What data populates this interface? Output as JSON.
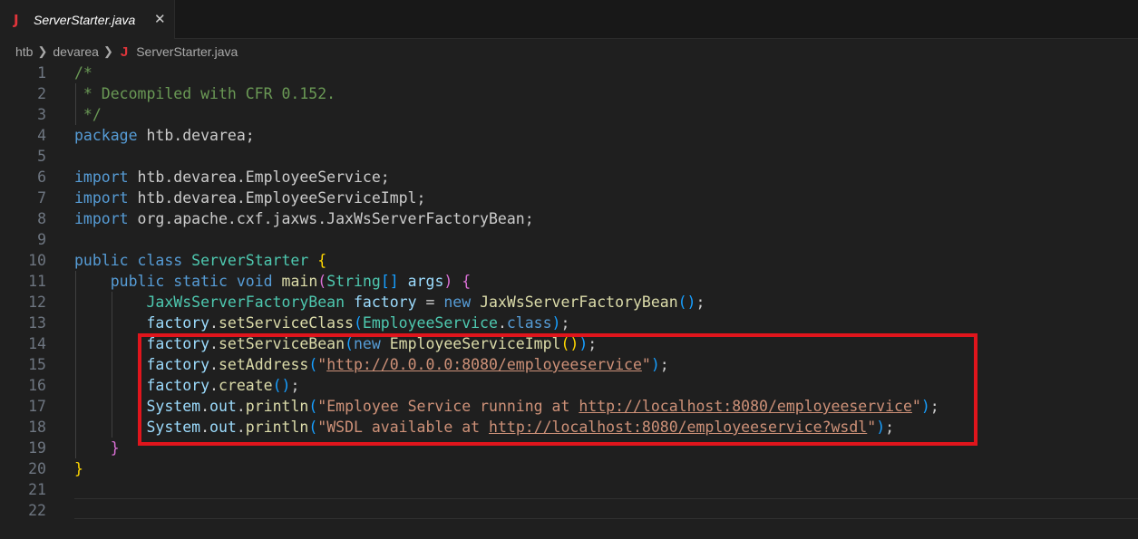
{
  "tab": {
    "icon": "java-file-icon",
    "label": "ServerStarter.java",
    "close_icon": "close-icon"
  },
  "breadcrumb": {
    "items": [
      "htb",
      "devarea"
    ],
    "file_icon": "java-file-icon",
    "file": "ServerStarter.java"
  },
  "colors": {
    "comment": "#6a9955",
    "keyword": "#569cd6",
    "type": "#4ec9b0",
    "function": "#dcdcaa",
    "variable": "#9cdcfe",
    "string": "#ce9178",
    "highlight_box": "#e0151c"
  },
  "editor": {
    "lines": [
      {
        "n": "1",
        "tokens": [
          [
            "comment",
            "/*"
          ]
        ]
      },
      {
        "n": "2",
        "tokens": [
          [
            "comment",
            " * Decompiled with CFR 0.152."
          ]
        ]
      },
      {
        "n": "3",
        "tokens": [
          [
            "comment",
            " */"
          ]
        ]
      },
      {
        "n": "4",
        "tokens": [
          [
            "kw",
            "package"
          ],
          [
            "plain",
            " htb.devarea;"
          ]
        ]
      },
      {
        "n": "5",
        "tokens": []
      },
      {
        "n": "6",
        "tokens": [
          [
            "kw",
            "import"
          ],
          [
            "plain",
            " htb.devarea.EmployeeService;"
          ]
        ]
      },
      {
        "n": "7",
        "tokens": [
          [
            "kw",
            "import"
          ],
          [
            "plain",
            " htb.devarea.EmployeeServiceImpl;"
          ]
        ]
      },
      {
        "n": "8",
        "tokens": [
          [
            "kw",
            "import"
          ],
          [
            "plain",
            " org.apache.cxf.jaxws.JaxWsServerFactoryBean;"
          ]
        ]
      },
      {
        "n": "9",
        "tokens": []
      },
      {
        "n": "10",
        "tokens": [
          [
            "kw",
            "public"
          ],
          [
            "plain",
            " "
          ],
          [
            "kw",
            "class"
          ],
          [
            "plain",
            " "
          ],
          [
            "type",
            "ServerStarter"
          ],
          [
            "plain",
            " "
          ],
          [
            "b1",
            "{"
          ]
        ]
      },
      {
        "n": "11",
        "tokens": [
          [
            "plain",
            "    "
          ],
          [
            "kw",
            "public"
          ],
          [
            "plain",
            " "
          ],
          [
            "kw",
            "static"
          ],
          [
            "plain",
            " "
          ],
          [
            "kw",
            "void"
          ],
          [
            "plain",
            " "
          ],
          [
            "fn",
            "main"
          ],
          [
            "b2",
            "("
          ],
          [
            "type",
            "String"
          ],
          [
            "b3",
            "[]"
          ],
          [
            "plain",
            " "
          ],
          [
            "var",
            "args"
          ],
          [
            "b2",
            ")"
          ],
          [
            "plain",
            " "
          ],
          [
            "b2",
            "{"
          ]
        ]
      },
      {
        "n": "12",
        "tokens": [
          [
            "plain",
            "        "
          ],
          [
            "type",
            "JaxWsServerFactoryBean"
          ],
          [
            "plain",
            " "
          ],
          [
            "var",
            "factory"
          ],
          [
            "plain",
            " = "
          ],
          [
            "kw",
            "new"
          ],
          [
            "plain",
            " "
          ],
          [
            "fn",
            "JaxWsServerFactoryBean"
          ],
          [
            "b3",
            "()"
          ],
          [
            "plain",
            ";"
          ]
        ]
      },
      {
        "n": "13",
        "tokens": [
          [
            "plain",
            "        "
          ],
          [
            "var",
            "factory"
          ],
          [
            "plain",
            "."
          ],
          [
            "fn",
            "setServiceClass"
          ],
          [
            "b3",
            "("
          ],
          [
            "type",
            "EmployeeService"
          ],
          [
            "plain",
            "."
          ],
          [
            "kw",
            "class"
          ],
          [
            "b3",
            ")"
          ],
          [
            "plain",
            ";"
          ]
        ]
      },
      {
        "n": "14",
        "tokens": [
          [
            "plain",
            "        "
          ],
          [
            "var",
            "factory"
          ],
          [
            "plain",
            "."
          ],
          [
            "fn",
            "setServiceBean"
          ],
          [
            "b3",
            "("
          ],
          [
            "kw",
            "new"
          ],
          [
            "plain",
            " "
          ],
          [
            "fn",
            "EmployeeServiceImpl"
          ],
          [
            "b1",
            "()"
          ],
          [
            "b3",
            ")"
          ],
          [
            "plain",
            ";"
          ]
        ]
      },
      {
        "n": "15",
        "tokens": [
          [
            "plain",
            "        "
          ],
          [
            "var",
            "factory"
          ],
          [
            "plain",
            "."
          ],
          [
            "fn",
            "setAddress"
          ],
          [
            "b3",
            "("
          ],
          [
            "str",
            "\""
          ],
          [
            "str url",
            "http://0.0.0.0:8080/employeeservice"
          ],
          [
            "str",
            "\""
          ],
          [
            "b3",
            ")"
          ],
          [
            "plain",
            ";"
          ]
        ]
      },
      {
        "n": "16",
        "tokens": [
          [
            "plain",
            "        "
          ],
          [
            "var",
            "factory"
          ],
          [
            "plain",
            "."
          ],
          [
            "fn",
            "create"
          ],
          [
            "b3",
            "()"
          ],
          [
            "plain",
            ";"
          ]
        ]
      },
      {
        "n": "17",
        "tokens": [
          [
            "plain",
            "        "
          ],
          [
            "var",
            "System"
          ],
          [
            "plain",
            "."
          ],
          [
            "var",
            "out"
          ],
          [
            "plain",
            "."
          ],
          [
            "fn",
            "println"
          ],
          [
            "b3",
            "("
          ],
          [
            "str",
            "\"Employee Service running at "
          ],
          [
            "str url",
            "http://localhost:8080/employeeservice"
          ],
          [
            "str",
            "\""
          ],
          [
            "b3",
            ")"
          ],
          [
            "plain",
            ";"
          ]
        ]
      },
      {
        "n": "18",
        "tokens": [
          [
            "plain",
            "        "
          ],
          [
            "var",
            "System"
          ],
          [
            "plain",
            "."
          ],
          [
            "var",
            "out"
          ],
          [
            "plain",
            "."
          ],
          [
            "fn",
            "println"
          ],
          [
            "b3",
            "("
          ],
          [
            "str",
            "\"WSDL available at "
          ],
          [
            "str url",
            "http://localhost:8080/employeeservice?wsdl"
          ],
          [
            "str",
            "\""
          ],
          [
            "b3",
            ")"
          ],
          [
            "plain",
            ";"
          ]
        ]
      },
      {
        "n": "19",
        "tokens": [
          [
            "plain",
            "    "
          ],
          [
            "b2",
            "}"
          ]
        ]
      },
      {
        "n": "20",
        "tokens": [
          [
            "b1",
            "}"
          ]
        ]
      },
      {
        "n": "21",
        "tokens": []
      },
      {
        "n": "22",
        "tokens": []
      }
    ]
  }
}
